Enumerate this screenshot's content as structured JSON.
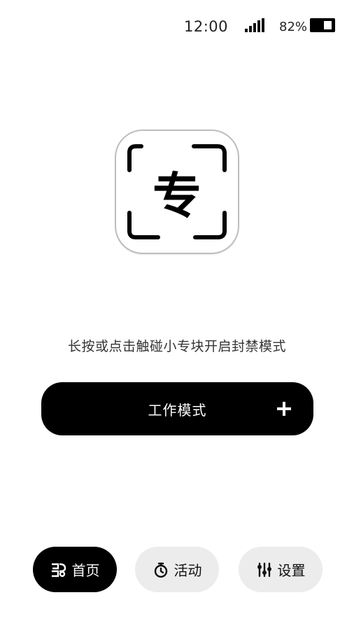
{
  "status_bar": {
    "time": "12:00",
    "battery_percent": "82%",
    "battery_level": 0.82,
    "icons": [
      "signal-icon",
      "battery-icon"
    ]
  },
  "logo": {
    "glyph": "专",
    "icon": "app-logo-icon"
  },
  "hint_text": "长按或点击触碰小专块开启封禁模式",
  "mode_button": {
    "label": "工作模式",
    "icon": "plus-icon"
  },
  "nav": {
    "tabs": [
      {
        "label": "首页",
        "icon": "home-icon",
        "active": true
      },
      {
        "label": "活动",
        "icon": "stopwatch-icon",
        "active": false
      },
      {
        "label": "设置",
        "icon": "sliders-icon",
        "active": false
      }
    ]
  },
  "colors": {
    "primary": "#000000",
    "inactive_tab": "#ececec",
    "background": "#ffffff"
  }
}
